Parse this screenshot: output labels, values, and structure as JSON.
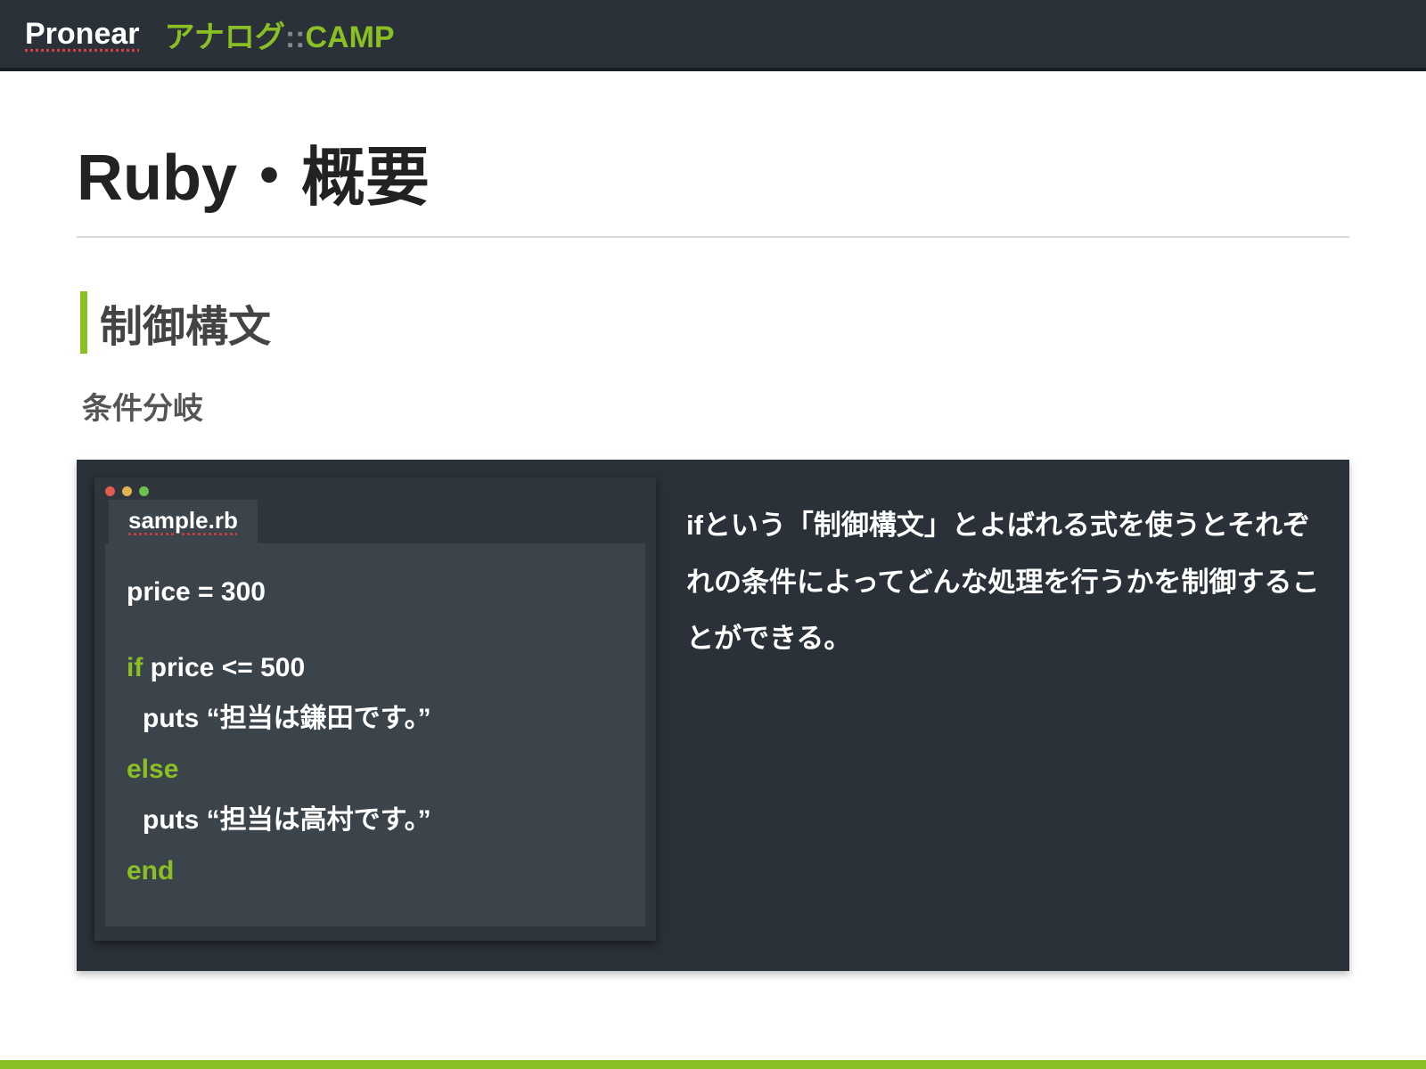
{
  "header": {
    "brand": "Pronear",
    "sub_green1": "アナログ",
    "sub_grey": "::",
    "sub_green2": "CAMP"
  },
  "page": {
    "title": "Ruby・概要",
    "section": "制御構文",
    "subsection": "条件分岐"
  },
  "editor": {
    "filename": "sample.rb",
    "code": {
      "l1_a": "price ",
      "l1_b": "= 300",
      "l2_kw": "if",
      "l2_rest": " price <= 500",
      "l3": "puts “担当は鎌田です。”",
      "l4_kw": "else",
      "l5": "puts “担当は高村です。”",
      "l6_kw": "end"
    }
  },
  "explain": {
    "text": "ifという「制御構文」とよばれる式を使うとそれぞれの条件によってどんな処理を行うかを制御することができる。"
  }
}
